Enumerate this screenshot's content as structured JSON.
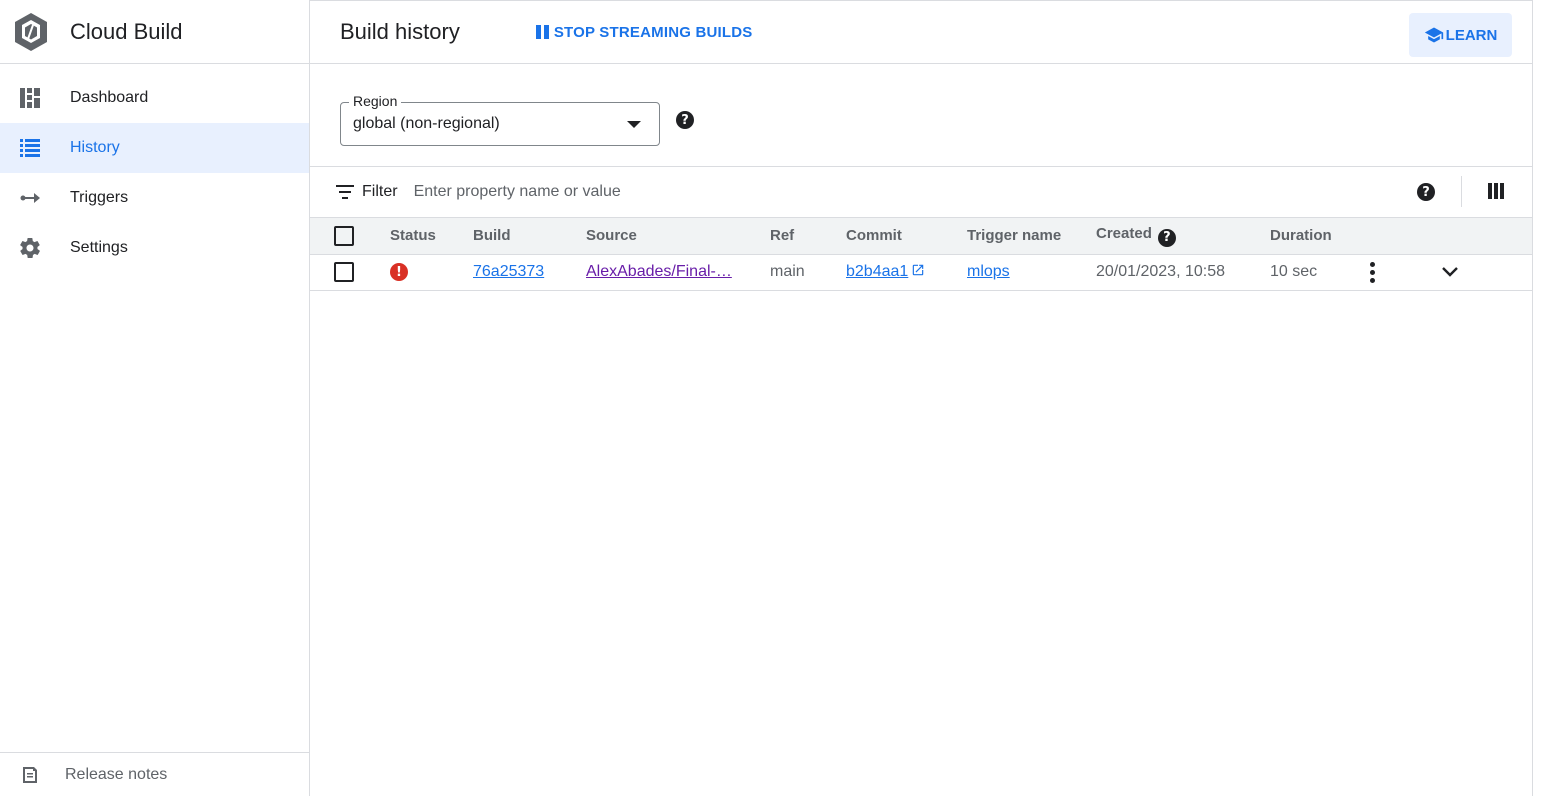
{
  "app": {
    "title": "Cloud Build",
    "logo_icon": "cloud-build-hex-icon"
  },
  "sidebar": {
    "items": [
      {
        "label": "Dashboard",
        "icon": "dashboard-icon",
        "active": false
      },
      {
        "label": "History",
        "icon": "list-icon",
        "active": true
      },
      {
        "label": "Triggers",
        "icon": "arrow-right-icon",
        "active": false
      },
      {
        "label": "Settings",
        "icon": "gear-icon",
        "active": false
      }
    ],
    "footer": {
      "label": "Release notes",
      "icon": "release-notes-icon"
    }
  },
  "header": {
    "title": "Build history",
    "stream_button": "STOP STREAMING BUILDS",
    "learn_button": "LEARN"
  },
  "region": {
    "label": "Region",
    "value": "global (non-regional)"
  },
  "filter": {
    "label": "Filter",
    "placeholder": "Enter property name or value"
  },
  "table": {
    "columns": {
      "status": "Status",
      "build": "Build",
      "source": "Source",
      "ref": "Ref",
      "commit": "Commit",
      "trigger": "Trigger name",
      "created": "Created",
      "duration": "Duration"
    },
    "rows": [
      {
        "status": "error",
        "build": "76a25373",
        "source": "AlexAbades/Final-…",
        "ref": "main",
        "commit": "b2b4aa1",
        "trigger": "mlops",
        "created": "20/01/2023, 10:58",
        "duration": "10 sec"
      }
    ]
  },
  "colors": {
    "accent": "#1a73e8",
    "active_bg": "#e8f0fe",
    "error": "#d93025",
    "visited_link": "#681da8"
  }
}
